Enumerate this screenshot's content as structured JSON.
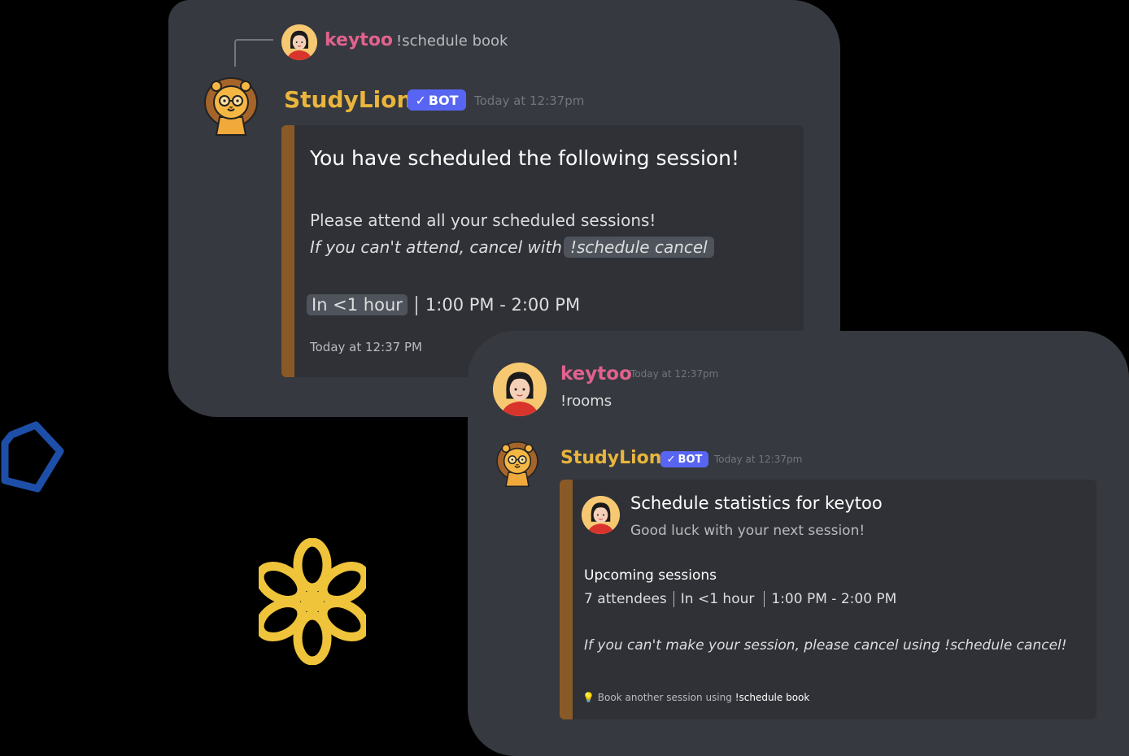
{
  "first_message": {
    "reply": {
      "author": "keytoo",
      "text": "!schedule book"
    },
    "author": "StudyLion",
    "badge": "BOT",
    "timestamp": "Today at 12:37pm",
    "embed": {
      "title": "You have scheduled the following session!",
      "line1": "Please attend all your scheduled sessions!",
      "line2_prefix": "If you can't attend, cancel with",
      "line2_code": "!schedule cancel",
      "time_pill": "In <1 hour",
      "time_range": "1:00 PM - 2:00 PM",
      "footer": "Today at 12:37 PM"
    }
  },
  "second_user_message": {
    "author": "keytoo",
    "timestamp": "Today at 12:37pm",
    "text": "!rooms"
  },
  "second_bot_message": {
    "author": "StudyLion",
    "badge": "BOT",
    "timestamp": "Today at 12:37pm",
    "embed": {
      "title": "Schedule statistics for keytoo",
      "subtitle": "Good luck with your next session!",
      "section_heading": "Upcoming sessions",
      "attendees": "7 attendees",
      "eta": "In <1 hour",
      "time_range": "1:00 PM - 2:00 PM",
      "note": "If you can't make your session, please cancel using !schedule cancel!",
      "footer_icon": "lightbulb-icon",
      "footer_prefix": "Book another session using",
      "footer_command": "!schedule book"
    }
  },
  "colors": {
    "user_name": "#e0628d",
    "bot_name": "#e9b53c",
    "embed_accent": "#8a5a26",
    "badge": "#5865f2",
    "decor_pentagon": "#1e4fa8",
    "decor_flower": "#f0c43a"
  }
}
